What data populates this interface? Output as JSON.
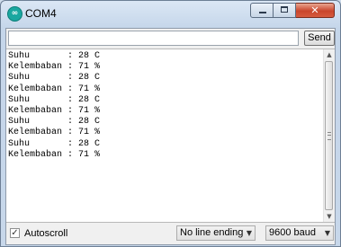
{
  "window": {
    "title": "COM4",
    "icon_name": "arduino-icon",
    "icon_glyph": "∞",
    "close_glyph": "✕"
  },
  "send_bar": {
    "input_value": "",
    "send_label": "Send"
  },
  "serial_output": {
    "lines": [
      "Suhu       : 28 C",
      "Kelembaban : 71 %",
      "Suhu       : 28 C",
      "Kelembaban : 71 %",
      "Suhu       : 28 C",
      "Kelembaban : 71 %",
      "Suhu       : 28 C",
      "Kelembaban : 71 %",
      "Suhu       : 28 C",
      "Kelembaban : 71 %"
    ]
  },
  "footer": {
    "autoscroll_label": "Autoscroll",
    "autoscroll_checked": true,
    "line_ending_value": "No line ending",
    "baud_value": "9600 baud"
  },
  "colors": {
    "close_button": "#c9452c",
    "app_icon": "#1aa7a0"
  }
}
